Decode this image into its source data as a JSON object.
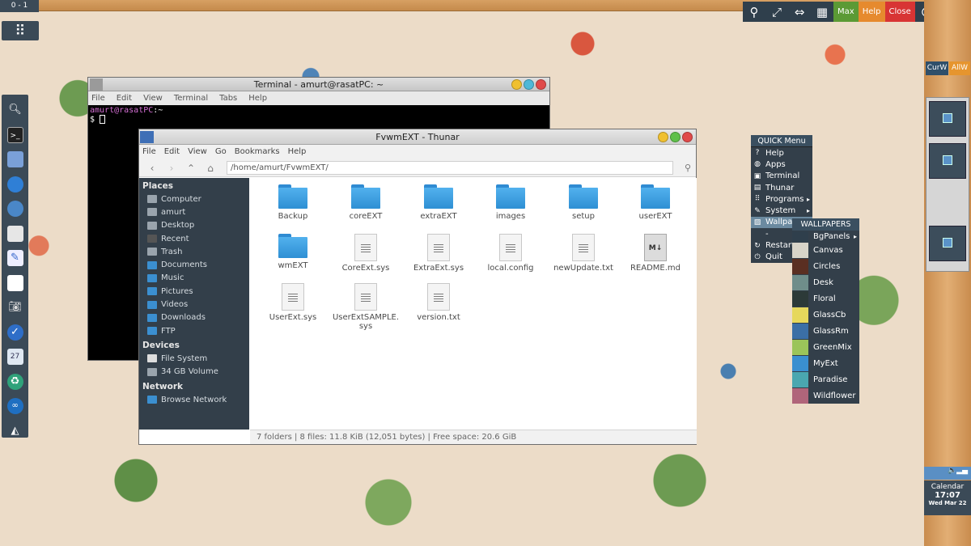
{
  "desktop": {
    "pager_label": "0 - 1"
  },
  "top_panel": {
    "max_label": "Max",
    "help_label": "Help",
    "close_label": "Close"
  },
  "right_panel": {
    "curw_label": "CurW",
    "allw_label": "AllW"
  },
  "clock": {
    "label": "Calendar",
    "time": "17:07",
    "date": "Wed Mar 22"
  },
  "dock": {
    "items": [
      "search-icon",
      "terminal-icon",
      "file-manager-icon",
      "chromium-icon",
      "mail-client-icon",
      "envelope-icon",
      "text-editor-icon",
      "blank-document-icon",
      "camera-icon",
      "feather-icon",
      "calendar-icon",
      "recycle-icon",
      "network-icon",
      "arch-icon"
    ]
  },
  "terminal": {
    "title": "Terminal - amurt@rasatPC: ~",
    "menu": [
      "File",
      "Edit",
      "View",
      "Terminal",
      "Tabs",
      "Help"
    ],
    "prompt_user": "amurt@rasatPC",
    "prompt_path": ":~",
    "prompt_symbol": "$"
  },
  "thunar": {
    "title": "FvwmEXT - Thunar",
    "menu": [
      "File",
      "Edit",
      "View",
      "Go",
      "Bookmarks",
      "Help"
    ],
    "location": "/home/amurt/FvwmEXT/",
    "places_header": "Places",
    "places": [
      "Computer",
      "amurt",
      "Desktop",
      "Recent",
      "Trash",
      "Documents",
      "Music",
      "Pictures",
      "Videos",
      "Downloads",
      "FTP"
    ],
    "devices_header": "Devices",
    "devices": [
      "File System",
      "34 GB Volume"
    ],
    "network_header": "Network",
    "network": [
      "Browse Network"
    ],
    "files": [
      {
        "name": "Backup",
        "type": "folder"
      },
      {
        "name": "coreEXT",
        "type": "folder"
      },
      {
        "name": "extraEXT",
        "type": "folder"
      },
      {
        "name": "images",
        "type": "folder"
      },
      {
        "name": "setup",
        "type": "folder"
      },
      {
        "name": "userEXT",
        "type": "folder"
      },
      {
        "name": "wmEXT",
        "type": "folder"
      },
      {
        "name": "CoreExt.sys",
        "type": "doc"
      },
      {
        "name": "ExtraExt.sys",
        "type": "doc"
      },
      {
        "name": "local.config",
        "type": "doc"
      },
      {
        "name": "newUpdate.txt",
        "type": "doc"
      },
      {
        "name": "README.md",
        "type": "md"
      },
      {
        "name": "UserExt.sys",
        "type": "doc"
      },
      {
        "name": "UserExtSAMPLE.\nsys",
        "type": "doc"
      },
      {
        "name": "version.txt",
        "type": "doc"
      }
    ],
    "status": "7 folders  |  8 files: 11.8 KiB (12,051 bytes)  |  Free space: 20.6 GiB",
    "md_badge": "M↓"
  },
  "quick_menu": {
    "title": "QUICK Menu",
    "items": [
      {
        "label": "Help",
        "icon": "help-icon",
        "submenu": false
      },
      {
        "label": "Apps",
        "icon": "globe-icon",
        "submenu": false
      },
      {
        "label": "Terminal",
        "icon": "terminal-icon",
        "submenu": false
      },
      {
        "label": "Thunar",
        "icon": "file-icon",
        "submenu": false
      },
      {
        "label": "Programs",
        "icon": "grid-icon",
        "submenu": true
      },
      {
        "label": "System",
        "icon": "wrench-icon",
        "submenu": true
      },
      {
        "label": "Wallpap",
        "icon": "wallpaper-icon",
        "submenu": false
      },
      {
        "label": "-",
        "icon": "",
        "submenu": false
      },
      {
        "label": "Restart",
        "icon": "restart-icon",
        "submenu": false
      },
      {
        "label": "Quit",
        "icon": "power-icon",
        "submenu": false
      }
    ]
  },
  "wallpapers_menu": {
    "title": "WALLPAPERS",
    "items": [
      {
        "label": "BgPanels",
        "submenu": true,
        "color": "#2f3f4c"
      },
      {
        "label": "Canvas",
        "submenu": false,
        "color": "#d8d4c8"
      },
      {
        "label": "Circles",
        "submenu": false,
        "color": "#5a2f22"
      },
      {
        "label": "Desk",
        "submenu": false,
        "color": "#6f8d8a"
      },
      {
        "label": "Floral",
        "submenu": false,
        "color": "#2c3a38"
      },
      {
        "label": "GlassCb",
        "submenu": false,
        "color": "#e6d85c"
      },
      {
        "label": "GlassRm",
        "submenu": false,
        "color": "#3b6fa6"
      },
      {
        "label": "GreenMix",
        "submenu": false,
        "color": "#9bc45a"
      },
      {
        "label": "MyExt",
        "submenu": false,
        "color": "#3a8fd0"
      },
      {
        "label": "Paradise",
        "submenu": false,
        "color": "#4aa7b0"
      },
      {
        "label": "Wildflower",
        "submenu": false,
        "color": "#b0657a"
      }
    ]
  }
}
